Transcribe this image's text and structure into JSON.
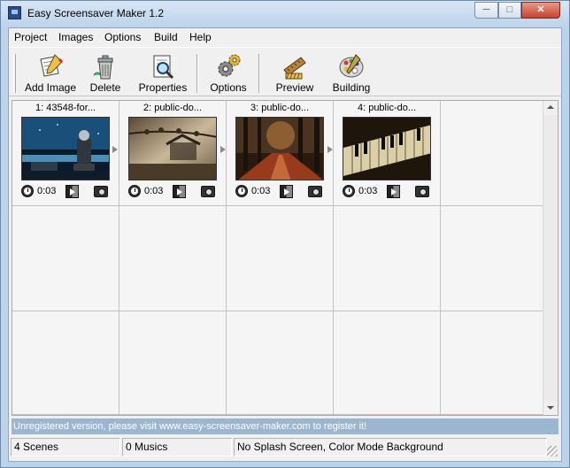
{
  "window": {
    "title": "Easy Screensaver Maker 1.2",
    "controls": {
      "minimize": "─",
      "maximize": "□",
      "close": "✕"
    }
  },
  "menubar": {
    "items": [
      "Project",
      "Images",
      "Options",
      "Build",
      "Help"
    ]
  },
  "toolbar": {
    "buttons": [
      {
        "label": "Add Image",
        "icon": "add-image-icon"
      },
      {
        "label": "Delete",
        "icon": "trash-icon"
      },
      {
        "label": "Properties",
        "icon": "properties-icon"
      },
      {
        "label": "Options",
        "icon": "gears-icon"
      },
      {
        "label": "Preview",
        "icon": "film-pencil-icon"
      },
      {
        "label": "Building",
        "icon": "palette-icon"
      }
    ]
  },
  "scenes": [
    {
      "title": "1: 43548-for...",
      "duration": "0:03"
    },
    {
      "title": "2: public-do...",
      "duration": "0:03"
    },
    {
      "title": "3: public-do...",
      "duration": "0:03"
    },
    {
      "title": "4: public-do...",
      "duration": "0:03"
    }
  ],
  "unregistered_notice": "Unregistered version, please visit www.easy-screensaver-maker.com to register it!",
  "statusbar": {
    "scenes": "4 Scenes",
    "musics": "0 Musics",
    "mode": "No Splash Screen, Color Mode Background"
  },
  "colors": {
    "titlebar": "#bcd3ea",
    "notice_bar": "#9cb6cf",
    "client_bg": "#f0f0f0"
  }
}
